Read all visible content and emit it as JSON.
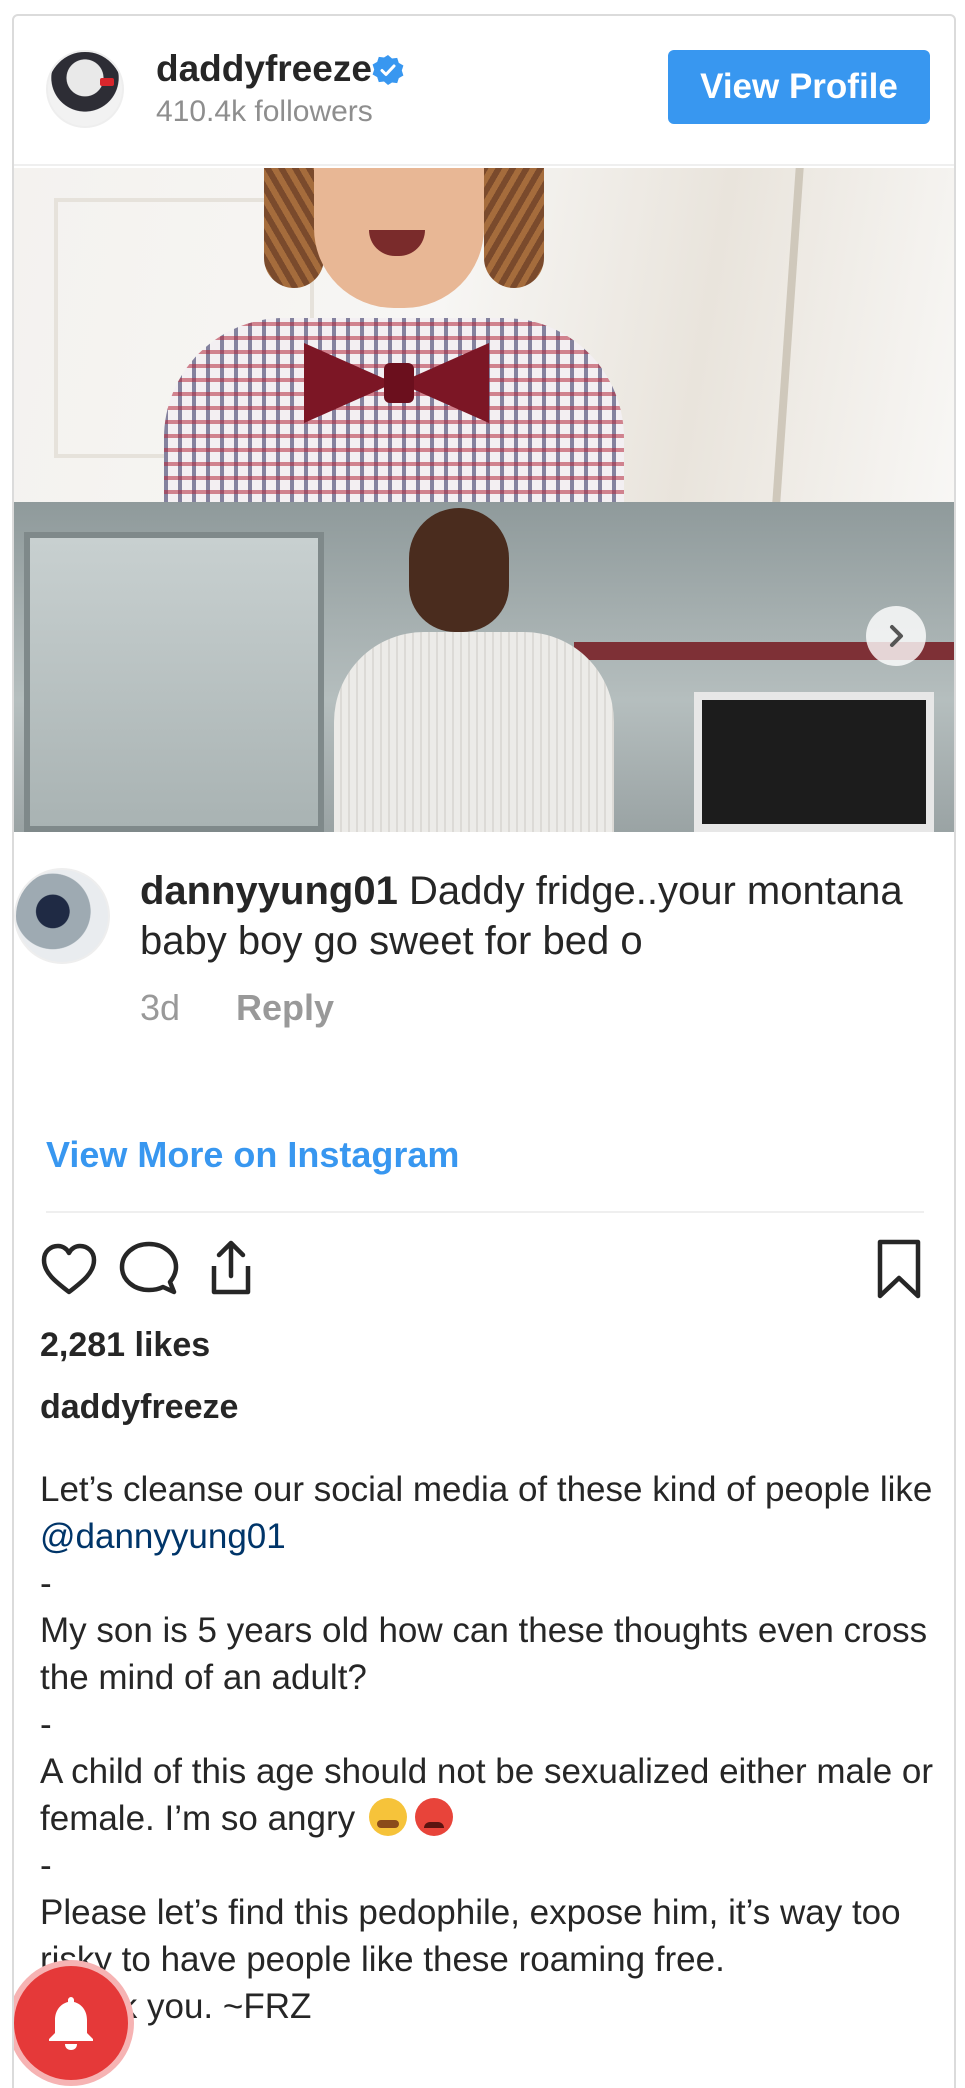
{
  "header": {
    "username": "daddyfreeze",
    "followers": "410.4k followers",
    "view_profile_label": "View Profile"
  },
  "comment": {
    "user": "dannyyung01",
    "text": " Daddy fridge..your montana baby boy go sweet for bed o",
    "time": "3d",
    "reply_label": "Reply"
  },
  "view_more_label": "View More on Instagram",
  "likes": "2,281 likes",
  "caption": {
    "user": "daddyfreeze",
    "line1": "Let’s cleanse our social media of these kind of people like ",
    "mention": "@dannyyung01",
    "sep": "-",
    "line2": "My son is 5 years old how can these thoughts even cross the mind of an adult?",
    "line3": "A child of this age should not be sexualized either male or female. I’m so angry ",
    "line4": "Please let’s find this pedophile, expose him, it’s way too risky to have people like these roaming free.",
    "line5": "Thank you. ~FRZ"
  },
  "icons": {
    "verified": "verified-badge-icon",
    "like": "heart-icon",
    "comment": "comment-bubble-icon",
    "share": "share-icon",
    "save": "bookmark-icon",
    "carousel_next": "chevron-right-icon",
    "notification": "bell-icon"
  },
  "colors": {
    "accent": "#3897f0",
    "mention": "#003569",
    "notification": "#e53939"
  }
}
